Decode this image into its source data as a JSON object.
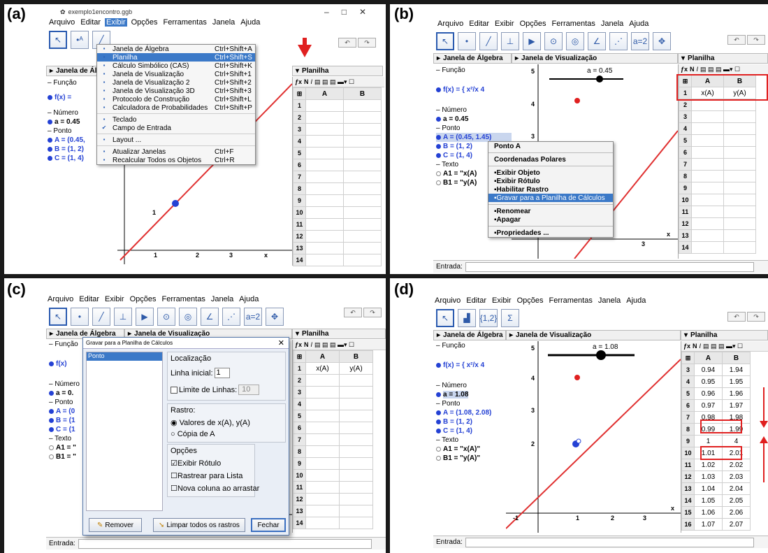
{
  "labels": {
    "a": "(a)",
    "b": "(b)",
    "c": "(c)",
    "d": "(d)"
  },
  "menu": [
    "Arquivo",
    "Editar",
    "Exibir",
    "Opções",
    "Ferramentas",
    "Janela",
    "Ajuda"
  ],
  "panelA": {
    "title": "exemplo1encontro.ggb",
    "dropdown": [
      {
        "label": "Janela de Álgebra",
        "shortcut": "Ctrl+Shift+A"
      },
      {
        "label": "Planilha",
        "shortcut": "Ctrl+Shift+S"
      },
      {
        "label": "Cálculo Simbólico (CAS)",
        "shortcut": "Ctrl+Shift+K"
      },
      {
        "label": "Janela de Visualização",
        "shortcut": "Ctrl+Shift+1"
      },
      {
        "label": "Janela de Visualização 2",
        "shortcut": "Ctrl+Shift+2"
      },
      {
        "label": "Janela de Visualização 3D",
        "shortcut": "Ctrl+Shift+3"
      },
      {
        "label": "Protocolo de Construção",
        "shortcut": "Ctrl+Shift+L"
      },
      {
        "label": "Calculadora de Probabilidades",
        "shortcut": "Ctrl+Shift+P"
      },
      {
        "label": "Teclado",
        "shortcut": ""
      },
      {
        "label": "Campo de Entrada",
        "shortcut": ""
      },
      {
        "label": "Layout ...",
        "shortcut": ""
      },
      {
        "label": "Atualizar Janelas",
        "shortcut": "Ctrl+F"
      },
      {
        "label": "Recalcular Todos os Objetos",
        "shortcut": "Ctrl+R"
      }
    ],
    "alg_header": "Janela de Álg",
    "funcao": "Função",
    "f_label": "f(x) =",
    "numero": "Número",
    "a_val": "a = 0.45",
    "ponto": "Ponto",
    "A_val": "A = (0.45,",
    "B_val": "B = (1, 2)",
    "C_val": "C = (1, 4)",
    "sheet_header": "Planilha",
    "rows": [
      "1",
      "2",
      "3",
      "4",
      "5",
      "6",
      "7",
      "8",
      "9",
      "10",
      "11",
      "12",
      "13",
      "14"
    ],
    "cols": [
      "A",
      "B"
    ]
  },
  "panelB": {
    "alg_header": "Janela de Álgebra",
    "view_header": "Janela de Visualização",
    "sheet_header": "Planilha",
    "slider": "a = 0.45",
    "funcao": "Função",
    "numero": "Número",
    "a_val": "a = 0.45",
    "ponto": "Ponto",
    "A_val": "A = (0.45, 1.45)",
    "B_val": "B = (1, 2)",
    "C_val": "C = (1, 4)",
    "texto": "Texto",
    "A1_val": "A1 = \"x(A)",
    "B1_val": "B1 = \"y(A)",
    "ctx": [
      "Ponto A",
      "Coordenadas Polares",
      "Exibir Objeto",
      "Exibir Rótulo",
      "Habilitar Rastro",
      "Gravar para a Planilha de Cálculos",
      "Renomear",
      "Apagar",
      "Propriedades ..."
    ],
    "cols": [
      "A",
      "B"
    ],
    "row1": [
      "x(A)",
      "y(A)"
    ],
    "rows": [
      "1",
      "2",
      "3",
      "4",
      "5",
      "6",
      "7",
      "8",
      "9",
      "10",
      "11",
      "12",
      "13",
      "14"
    ],
    "entrada": "Entrada:"
  },
  "panelC": {
    "alg_header": "Janela de Álgebra",
    "view_header": "Janela de Visualização",
    "sheet_header": "Planilha",
    "dialog_title": "Gravar para a Planilha de Cálculos",
    "list_item": "Ponto",
    "localizacao": "Localização",
    "linha_inicial": "Linha inicial:",
    "linha_val": "1",
    "limite": "Limite de Linhas:",
    "limite_val": "10",
    "rastro": "Rastro:",
    "valores": "Valores de x(A), y(A)",
    "copia": "Cópia de A",
    "opcoes": "Opções",
    "exibir_rotulo": "Exibir Rótulo",
    "rastrear": "Rastrear para Lista",
    "nova_coluna": "Nova coluna ao arrastar",
    "remover": "Remover",
    "limpar": "Limpar todos os rastros",
    "fechar": "Fechar",
    "funcao": "Função",
    "numero": "Número",
    "a_val": "a = 0.",
    "ponto": "Ponto",
    "texto": "Texto",
    "A1_val": "A1 = \"",
    "B1_val": "B1 = \"",
    "cols": [
      "A",
      "B"
    ],
    "row1": [
      "x(A)",
      "y(A)"
    ],
    "rows": [
      "1",
      "2",
      "3",
      "4",
      "5",
      "6",
      "7",
      "8",
      "9",
      "10",
      "11",
      "12",
      "13",
      "14"
    ],
    "entrada": "Entrada:"
  },
  "panelD": {
    "alg_header": "Janela de Álgebra",
    "view_header": "Janela de Visualização",
    "sheet_header": "Planilha",
    "slider": "a = 1.08",
    "funcao": "Função",
    "numero": "Número",
    "a_val": "a = 1.08",
    "ponto": "Ponto",
    "A_val": "A = (1.08, 2.08)",
    "B_val": "B = (1, 2)",
    "C_val": "C = (1, 4)",
    "texto": "Texto",
    "A1_val": "A1 = \"x(A)\"",
    "B1_val": "B1 = \"y(A)\"",
    "cols": [
      "A",
      "B"
    ],
    "table": [
      [
        "3",
        "0.94",
        "1.94"
      ],
      [
        "4",
        "0.95",
        "1.95"
      ],
      [
        "5",
        "0.96",
        "1.96"
      ],
      [
        "6",
        "0.97",
        "1.97"
      ],
      [
        "7",
        "0.98",
        "1.98"
      ],
      [
        "8",
        "0.99",
        "1.99"
      ],
      [
        "9",
        "1",
        "4"
      ],
      [
        "10",
        "1.01",
        "2.01"
      ],
      [
        "11",
        "1.02",
        "2.02"
      ],
      [
        "12",
        "1.03",
        "2.03"
      ],
      [
        "13",
        "1.04",
        "2.04"
      ],
      [
        "14",
        "1.05",
        "2.05"
      ],
      [
        "15",
        "1.06",
        "2.06"
      ],
      [
        "16",
        "1.07",
        "2.07"
      ]
    ],
    "entrada": "Entrada:"
  },
  "colors": {
    "accent": "#3b79c8",
    "red": "#e02020",
    "line": "#e03030",
    "point": "#2441d4"
  }
}
